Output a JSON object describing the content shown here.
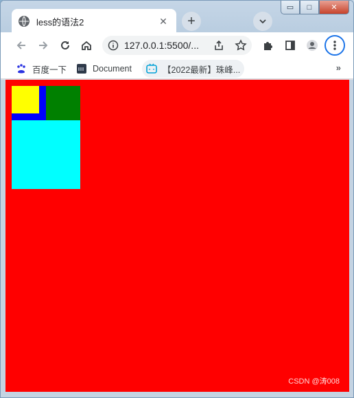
{
  "tab": {
    "title": "less的语法2",
    "close_glyph": "✕"
  },
  "tabstrip": {
    "new_tab_glyph": "+"
  },
  "window_controls": {
    "minimize_glyph": "▭",
    "maximize_glyph": "□",
    "close_glyph": "✕"
  },
  "toolbar": {
    "url": "127.0.0.1:5500/..."
  },
  "bookmarks": {
    "items": [
      {
        "label": "百度一下"
      },
      {
        "label": "Document"
      },
      {
        "label": "【2022最新】珠峰..."
      }
    ],
    "more_glyph": "»"
  },
  "page": {
    "background": "#ff0000",
    "boxes": {
      "blue": "#0000ff",
      "yellow": "#ffff00",
      "green": "#008000",
      "cyan": "#00ffff"
    }
  },
  "watermark": "CSDN @涛008"
}
